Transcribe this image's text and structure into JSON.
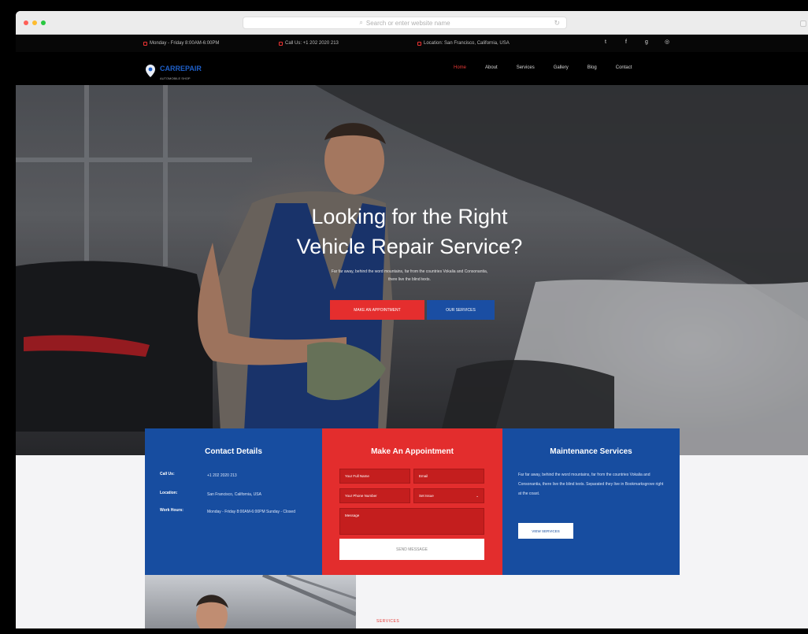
{
  "browser": {
    "address_placeholder": "Search or enter website name"
  },
  "topbar": {
    "hours": "Monday - Friday 8:00AM-6:00PM",
    "phone": "Call Us: +1 202 2020 213",
    "location": "Location: San Francisco, California, USA"
  },
  "brand": {
    "name": "CARREPAIR",
    "tagline": "AUTOMOBILE SHOP"
  },
  "nav": {
    "items": [
      "Home",
      "About",
      "Services",
      "Gallery",
      "Blog",
      "Contact"
    ],
    "active": "Home"
  },
  "hero": {
    "title_line1": "Looking for the Right",
    "title_line2": "Vehicle Repair Service?",
    "subtitle_line1": "Far far away, behind the word mountains, far from the countries Vokalia and Consonantia,",
    "subtitle_line2": "there live the blind texts.",
    "primary_button": "MAKE AN APPOINTMENT",
    "secondary_button": "OUR SERVICES"
  },
  "contact": {
    "title": "Contact Details",
    "rows": [
      {
        "label": "Call Us:",
        "value": "+1 202 2020 213"
      },
      {
        "label": "Location:",
        "value": "San Francisco, California, USA"
      },
      {
        "label": "Work Hours:",
        "value": "Monday - Friday 8:00AM-6:00PM Sunday - Closed"
      }
    ]
  },
  "appointment": {
    "title": "Make An Appointment",
    "name_placeholder": "Your Full Name",
    "email_placeholder": "Email",
    "phone_placeholder": "Your Phone Number",
    "service_select": "Set Issue",
    "message_placeholder": "Message",
    "submit": "SEND MESSAGE"
  },
  "maintenance": {
    "title": "Maintenance Services",
    "text": "Far far away, behind the word mountains, far from the countries Vokalia and Consonantia, there live the blind texts. Separated they live in Bookmarksgrove right at the coast.",
    "button": "VIEW SERVICES"
  },
  "bottom": {
    "label": "SERVICES"
  },
  "colors": {
    "accent_red": "#e32d2d",
    "brand_blue": "#174da0",
    "topbar_bg": "#070707"
  }
}
